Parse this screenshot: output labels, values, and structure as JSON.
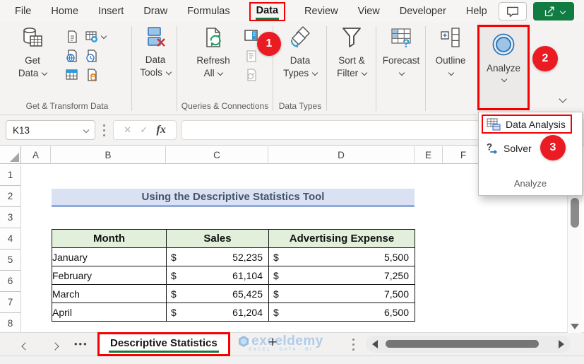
{
  "menu": {
    "items": [
      "File",
      "Home",
      "Insert",
      "Draw",
      "Formulas",
      "Data",
      "Review",
      "View",
      "Developer",
      "Help"
    ],
    "active": "Data"
  },
  "ribbon": {
    "get_data": {
      "line1": "Get",
      "line2": "Data"
    },
    "group1_label": "Get & Transform Data",
    "data_tools": {
      "line1": "Data",
      "line2": "Tools"
    },
    "refresh": {
      "line1": "Refresh",
      "line2": "All"
    },
    "group3_label": "Queries & Connections",
    "data_types": {
      "line1": "Data",
      "line2": "Types"
    },
    "group4_label": "Data Types",
    "sort_filter": {
      "line1": "Sort &",
      "line2": "Filter"
    },
    "forecast": {
      "line1": "Forecast"
    },
    "outline": {
      "line1": "Outline"
    },
    "analyze": {
      "label": "Analyze"
    }
  },
  "callouts": {
    "step1": "1",
    "step2": "2",
    "step3": "3"
  },
  "dropdown": {
    "item1": "Data Analysis",
    "item2": "Solver",
    "footer": "Analyze"
  },
  "formula_bar": {
    "name_box": "K13",
    "cancel_glyph": "✕",
    "enter_glyph": "✓",
    "fx_label": "fx",
    "value": ""
  },
  "sheet": {
    "col_headers": [
      "A",
      "B",
      "C",
      "D",
      "E",
      "F"
    ],
    "row_headers": [
      "1",
      "2",
      "3",
      "4",
      "5",
      "6",
      "7",
      "8"
    ],
    "banner_title": "Using the Descriptive Statistics Tool",
    "table": {
      "col_month": "Month",
      "col_sales": "Sales",
      "col_expense": "Advertising Expense",
      "currency": "$",
      "rows": [
        {
          "month": "January",
          "sales": "52,235",
          "expense": "5,500"
        },
        {
          "month": "February",
          "sales": "61,104",
          "expense": "7,250"
        },
        {
          "month": "March",
          "sales": "65,425",
          "expense": "7,500"
        },
        {
          "month": "April",
          "sales": "61,204",
          "expense": "6,500"
        }
      ]
    }
  },
  "tabbar": {
    "sheet_name": "Descriptive Statistics",
    "ellipsis": "•••",
    "plus": "+"
  },
  "watermark": {
    "name": "exceldemy",
    "tagline": "EXCEL · DATA · BI"
  },
  "colors": {
    "excel_green": "#107c41",
    "callout_red": "#ea1b23",
    "box_red": "#f60000",
    "banner_bg": "#d9e1f2",
    "banner_border": "#8ea9db",
    "banner_text": "#44546a",
    "table_header_bg": "#e2efda"
  }
}
